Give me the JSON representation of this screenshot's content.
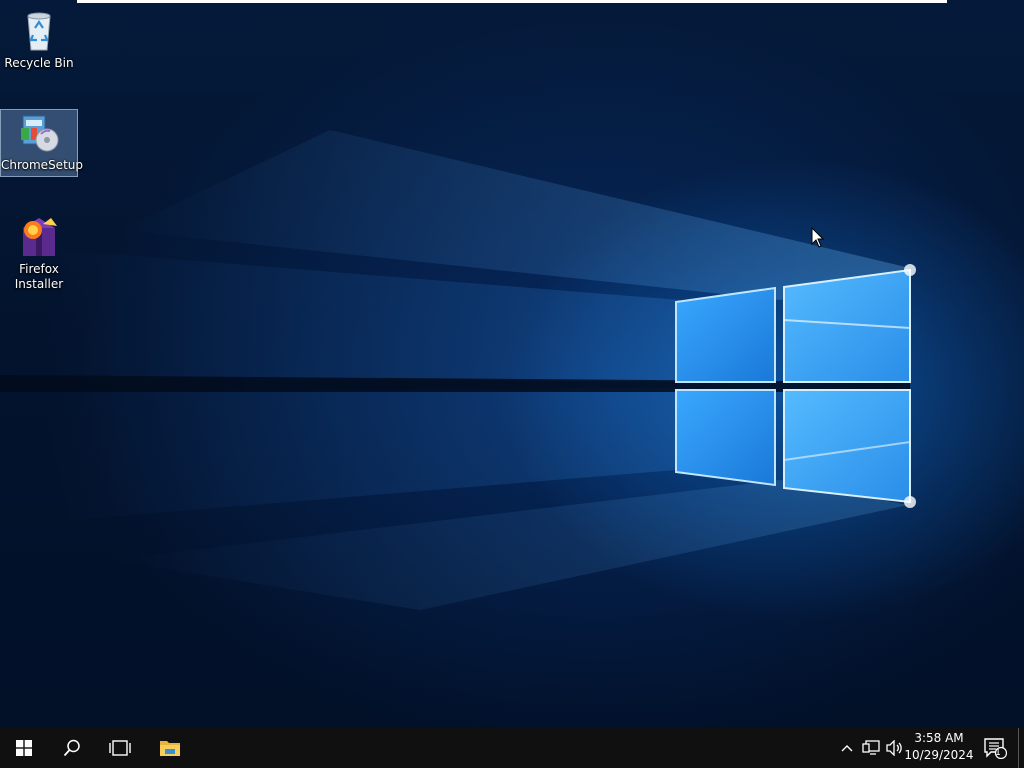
{
  "desktop": {
    "icons": [
      {
        "label": "Recycle Bin",
        "icon": "recycle-bin-icon"
      },
      {
        "label": "ChromeSetup",
        "icon": "installer-disc-icon",
        "selected": true
      },
      {
        "label": "Firefox\nInstaller",
        "label_line1": "Firefox",
        "label_line2": "Installer",
        "icon": "firefox-installer-icon"
      }
    ],
    "wallpaper": "windows-10-hero",
    "accent_color": "#1e90ff"
  },
  "taskbar": {
    "start_icon": "windows-start-icon",
    "search_icon": "search-icon",
    "task_view_icon": "task-view-icon",
    "pinned": [
      {
        "name": "File Explorer",
        "icon": "file-explorer-icon"
      }
    ],
    "tray": {
      "icons": [
        "chevron-up-icon",
        "network-icon",
        "volume-icon"
      ],
      "time": "3:58 AM",
      "date": "10/29/2024",
      "notification_count": "1"
    },
    "background": "#101010"
  }
}
